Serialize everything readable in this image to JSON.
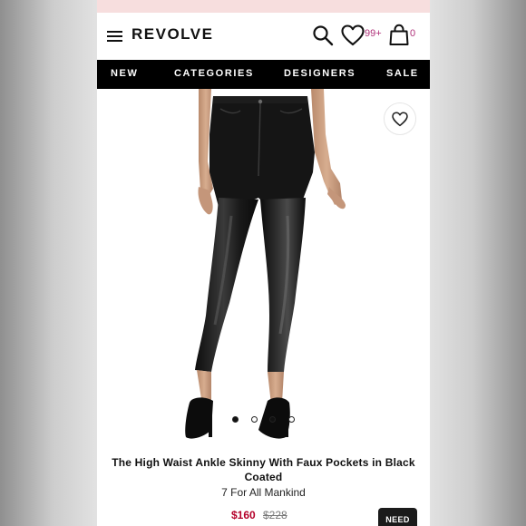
{
  "header": {
    "brand": "REVOLVE",
    "wishlist_count": "99+",
    "bag_count": "0"
  },
  "nav": {
    "items": [
      "NEW",
      "CATEGORIES",
      "DESIGNERS",
      "SALE"
    ]
  },
  "gallery": {
    "total_images": 4,
    "active_index": 0
  },
  "product": {
    "title_line1": "The High Waist Ankle Skinny With Faux Pockets in Black",
    "title_line2": "Coated",
    "brand": "7 For All Mankind",
    "sale_price": "$160",
    "original_price": "$228",
    "badge": "NEED"
  },
  "colors": {
    "sale_price": "#b4002a",
    "accent_count": "#b0327a",
    "nav_background": "#000000",
    "promo_strip": "#f7dede"
  },
  "icons": [
    "menu-icon",
    "search-icon",
    "heart-icon",
    "shopping-bag-icon"
  ]
}
